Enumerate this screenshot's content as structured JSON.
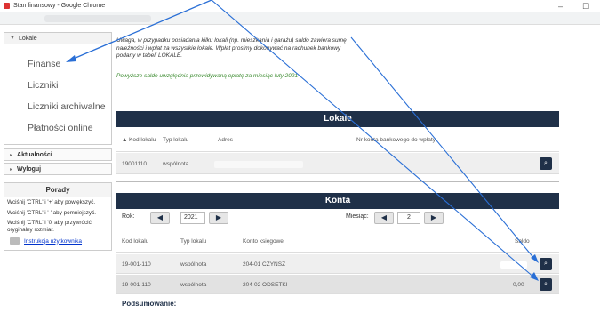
{
  "window": {
    "title": "Stan finansowy - Google Chrome",
    "minimize": "–",
    "maximize": "☐"
  },
  "sidebar": {
    "section": "Lokale",
    "items": [
      {
        "label": "Finanse"
      },
      {
        "label": "Liczniki"
      },
      {
        "label": "Liczniki archiwalne"
      },
      {
        "label": "Płatności online"
      }
    ],
    "links": [
      {
        "label": "Aktualności"
      },
      {
        "label": "Wyloguj"
      }
    ]
  },
  "porady": {
    "title": "Porady",
    "tips": [
      "Wciśnij 'CTRL' i '+' aby powiększyć.",
      "Wciśnij 'CTRL' i '-' aby pomniejszyć.",
      "Wciśnij 'CTRL' i '0' aby przywrócić oryginalny rozmiar."
    ],
    "manual": "Instrukcja użytkownika"
  },
  "main": {
    "notice": "Uwaga, w przypadku posiadania kilku lokali (np. mieszkania i garażu) saldo zawiera sumę należności i wpłat za wszystkie lokale. Wpłat prosimy dokonywać na rachunek bankowy podany w tabeli LOKALE.",
    "notice2": "Powyższe saldo uwzględnia przewidywaną opłatę za miesiąc luty 2021"
  },
  "lokale": {
    "title": "Lokale",
    "columns": [
      "Kod lokalu",
      "Typ lokalu",
      "Adres",
      "Nr konta bankowego do wpłaty"
    ],
    "rows": [
      {
        "kod": "19001110",
        "typ": "wspólnota"
      }
    ]
  },
  "konta": {
    "title": "Konta",
    "rok_label": "Rok:",
    "rok_value": "2021",
    "miesiac_label": "Miesiąc:",
    "miesiac_value": "2",
    "columns": [
      "Kod lokalu",
      "Typ lokalu",
      "Konto księgowe",
      "Saldo"
    ],
    "rows": [
      {
        "kod": "19-001-110",
        "typ": "wspólnota",
        "konto": "204-01 CZYNSZ",
        "saldo": ""
      },
      {
        "kod": "19-001-110",
        "typ": "wspólnota",
        "konto": "204-02 ODSETKI",
        "saldo": "0,00"
      }
    ],
    "summary": "Podsumowanie:"
  },
  "icons": {
    "sort": "▲",
    "prev": "◀",
    "next": "▶",
    "search": "magnifier-icon"
  },
  "colors": {
    "header_bar": "#1f3048",
    "notice_green": "#3a8a2e",
    "arrow": "#2a6fd6"
  }
}
